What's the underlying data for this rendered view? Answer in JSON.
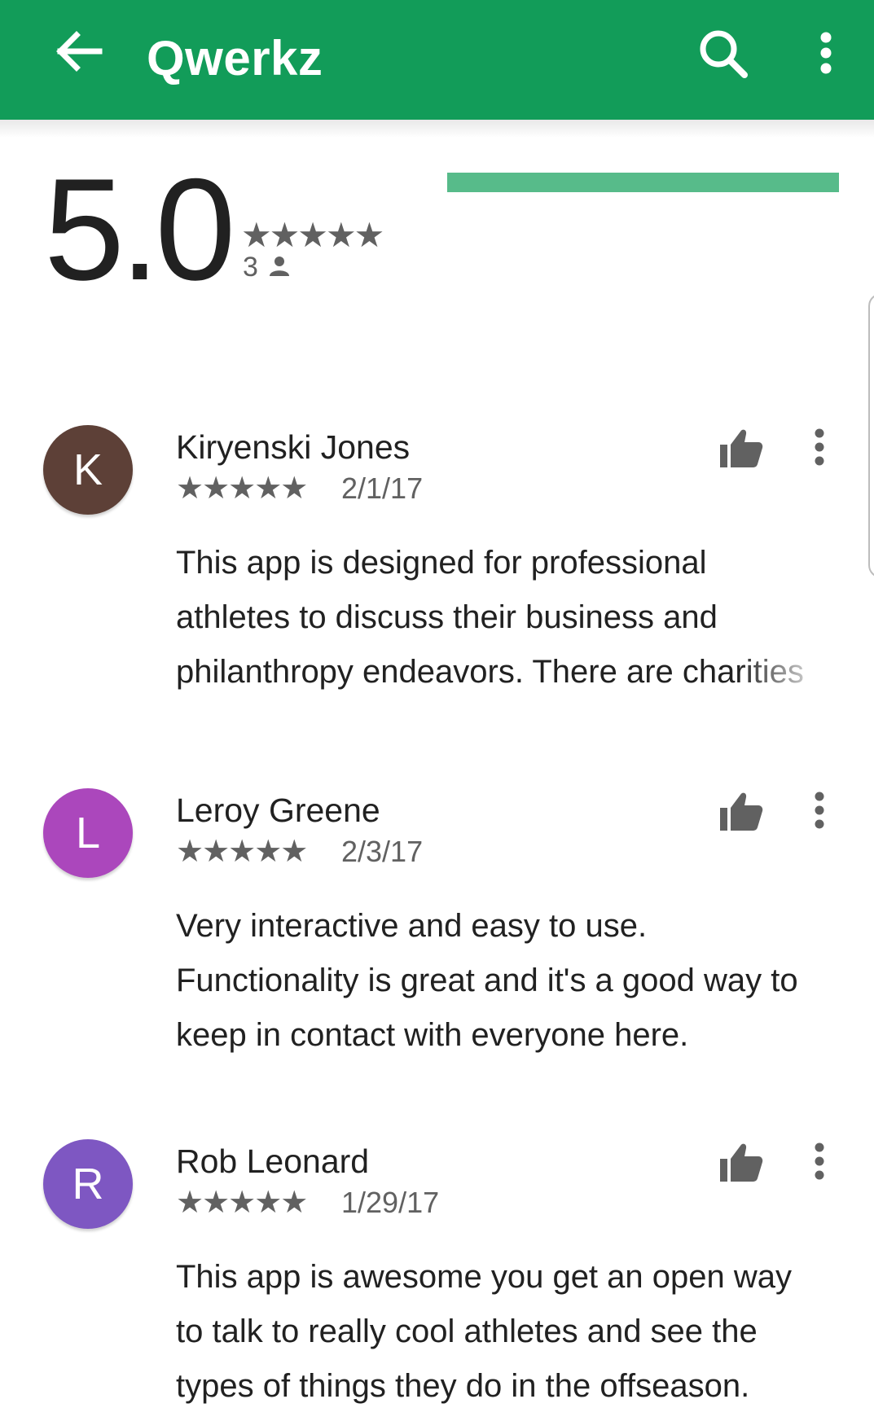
{
  "colors": {
    "accent": "#129c59",
    "rating_bar": "#57bb8a",
    "avatar_k": "#5d4037",
    "avatar_l": "#ab47bc",
    "avatar_r": "#7e57c2"
  },
  "header": {
    "title": "Qwerkz",
    "icons": [
      "back-arrow-icon",
      "search-icon",
      "more-vert-icon"
    ]
  },
  "rating": {
    "score": "5.0",
    "stars": "★★★★★",
    "count": "3",
    "five_star_fraction": 1.0
  },
  "reviews": [
    {
      "initial": "K",
      "name": "Kiryenski Jones",
      "stars": "★★★★★",
      "date": "2/1/17",
      "text": "This app is designed for professional athletes to discuss their business and philanthropy endeavors. There are charities"
    },
    {
      "initial": "L",
      "name": "Leroy Greene",
      "stars": "★★★★★",
      "date": "2/3/17",
      "text": "Very interactive and easy to use. Functionality is great and it's a good way to keep in contact with everyone here."
    },
    {
      "initial": "R",
      "name": "Rob Leonard",
      "stars": "★★★★★",
      "date": "1/29/17",
      "text": "This app is awesome you get an open way to talk to really cool athletes and see the types of things they do in the offseason."
    }
  ]
}
